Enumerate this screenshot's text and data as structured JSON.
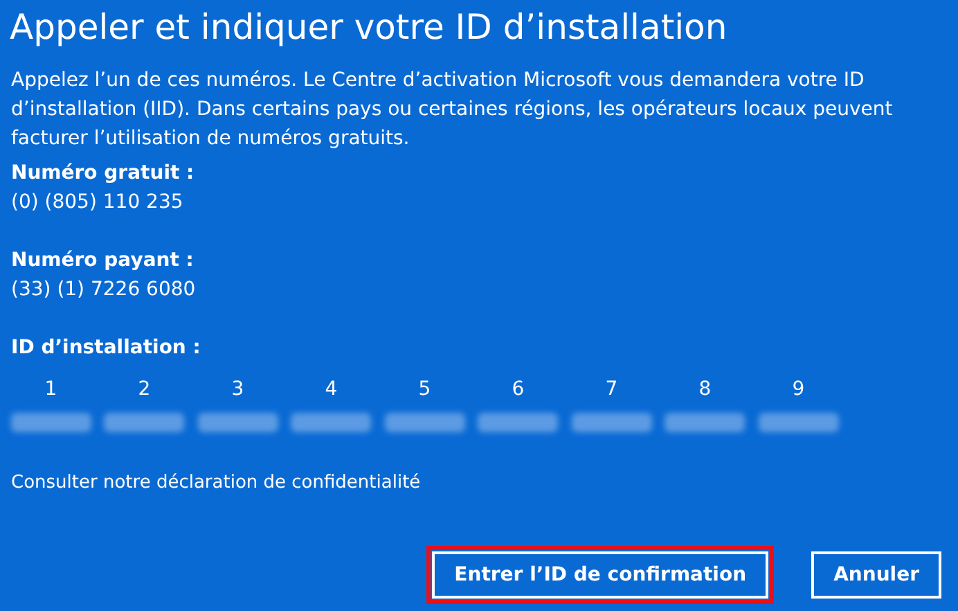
{
  "title": "Appeler et indiquer votre ID d’installation",
  "intro": "Appelez l’un de ces numéros. Le Centre d’activation Microsoft vous demandera votre ID d’installation (IID). Dans certains pays ou certaines régions, les opérateurs locaux peuvent facturer l’utilisation de numéros gratuits.",
  "numbers": [
    {
      "label": "Numéro gratuit :",
      "value": "(0) (805) 110 235"
    },
    {
      "label": "Numéro payant :",
      "value": "(33) (1) 7226 6080"
    }
  ],
  "installation_id": {
    "label": "ID d’installation :",
    "groups": [
      "1",
      "2",
      "3",
      "4",
      "5",
      "6",
      "7",
      "8",
      "9"
    ]
  },
  "privacy_link": "Consulter notre déclaration de confidentialité",
  "buttons": [
    {
      "label": "Entrer l’ID de confirmation",
      "highlighted": true
    },
    {
      "label": "Annuler",
      "highlighted": false
    }
  ]
}
